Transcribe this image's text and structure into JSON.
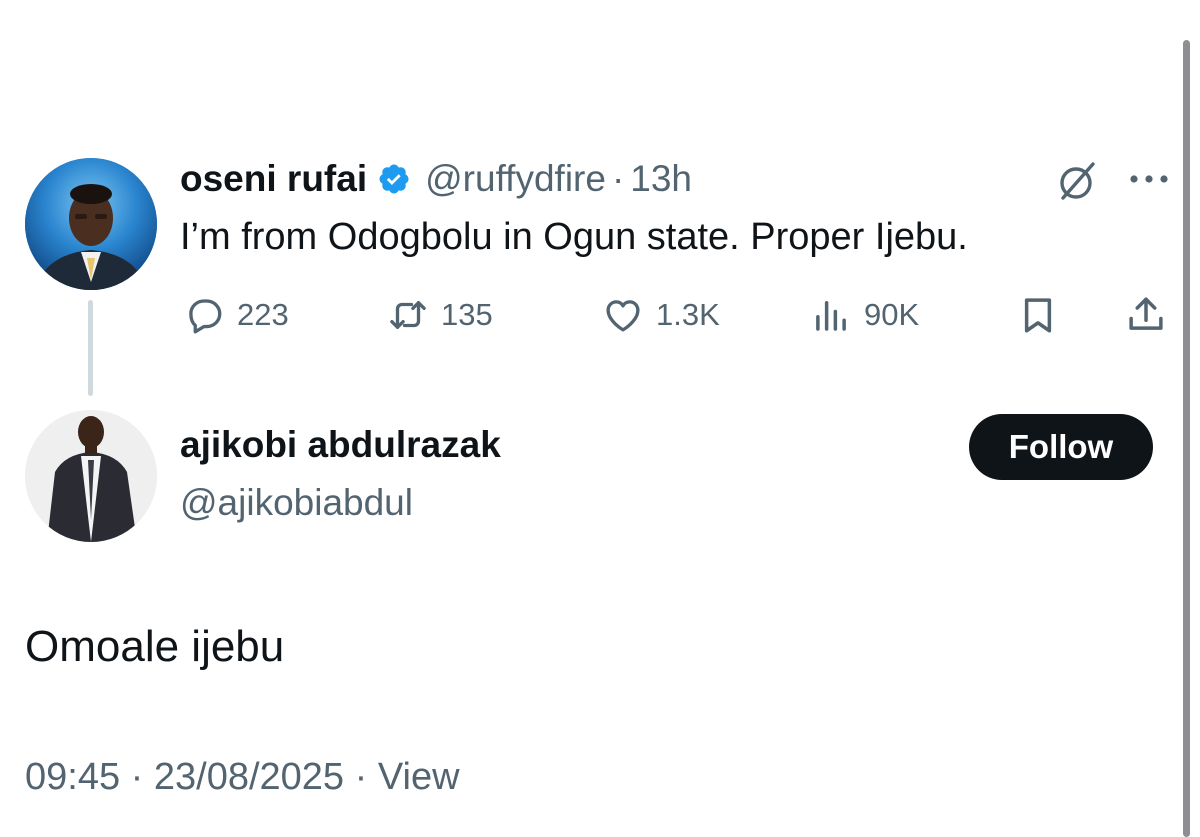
{
  "parent_tweet": {
    "author_name": "oseni rufai",
    "verified": true,
    "handle": "@ruffydfire",
    "separator": "·",
    "time_ago": "13h",
    "text": "I’m from Odogbolu in Ogun state. Proper Ijebu.",
    "metrics": {
      "replies": "223",
      "reposts": "135",
      "likes": "1.3K",
      "views": "90K"
    },
    "icons": [
      "grok-icon",
      "more-icon",
      "reply-icon",
      "repost-icon",
      "like-icon",
      "views-icon",
      "bookmark-icon",
      "share-icon"
    ]
  },
  "reply_tweet": {
    "author_name": "ajikobi abdulrazak",
    "handle": "@ajikobiabdul",
    "follow_label": "Follow",
    "text": "Omoale ijebu",
    "time": "09:45",
    "separator": "·",
    "date": "23/08/2025",
    "view_label": "View"
  },
  "colors": {
    "text_primary": "#0f1419",
    "text_secondary": "#536471",
    "verified_blue": "#1d9bf0",
    "follow_bg": "#0f1419",
    "thread_line": "#cfd9de"
  }
}
